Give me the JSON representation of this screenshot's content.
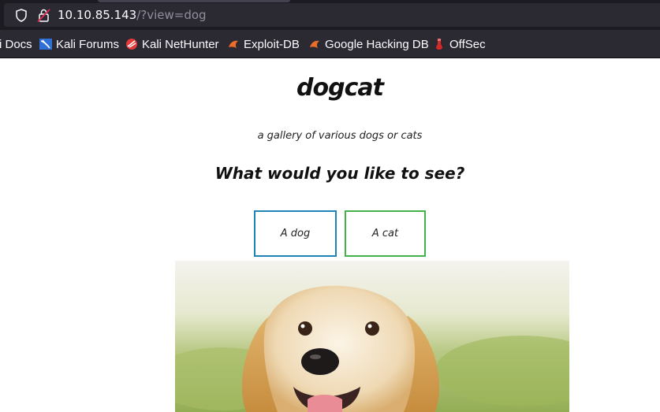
{
  "browser": {
    "url_host": "10.10.85.143",
    "url_path": "/?view=dog",
    "bookmarks": [
      {
        "label": "i Docs",
        "icon": "kali-docs-icon"
      },
      {
        "label": "Kali Forums",
        "icon": "kali-forums-icon"
      },
      {
        "label": "Kali NetHunter",
        "icon": "nethunter-icon"
      },
      {
        "label": "Exploit-DB",
        "icon": "exploit-db-icon"
      },
      {
        "label": "Google Hacking DB",
        "icon": "ghdb-icon"
      },
      {
        "label": "OffSec",
        "icon": "offsec-icon"
      }
    ]
  },
  "page": {
    "title": "dogcat",
    "subtitle": "a gallery of various dogs or cats",
    "question": "What would you like to see?",
    "choices": [
      {
        "label": "A dog",
        "border_color": "#1f84b5"
      },
      {
        "label": "A cat",
        "border_color": "#44b14a"
      }
    ],
    "image": "golden-retriever-dog-photo"
  },
  "colors": {
    "chrome_dark": "#1c1b22",
    "urlbar": "#2b2a33",
    "url_host_text": "#fbfbfe",
    "url_path_text": "#8f8f9d"
  }
}
